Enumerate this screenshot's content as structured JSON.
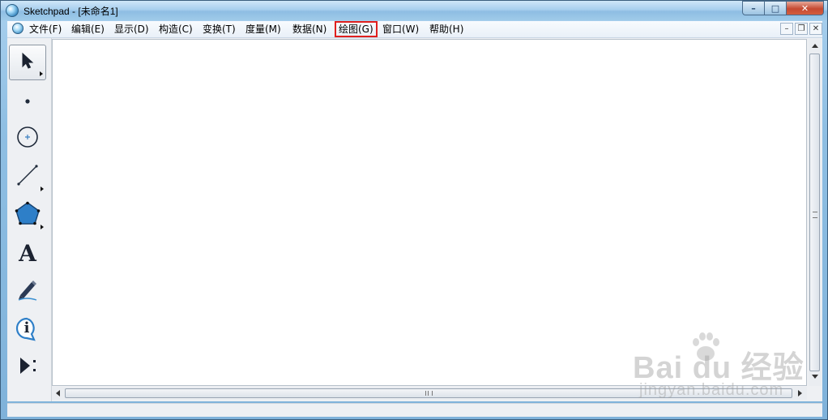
{
  "window": {
    "title": "Sketchpad  - [未命名1]",
    "controls": {
      "minimize": "–",
      "maximize": "□",
      "close": "✕"
    }
  },
  "menubar": {
    "items": [
      {
        "label": "文件(F)"
      },
      {
        "label": "编辑(E)"
      },
      {
        "label": "显示(D)"
      },
      {
        "label": "构造(C)"
      },
      {
        "label": "变换(T)"
      },
      {
        "label": "度量(M)"
      },
      {
        "label": "数据(N)"
      },
      {
        "label": "绘图(G)",
        "highlighted": true
      },
      {
        "label": "窗口(W)"
      },
      {
        "label": "帮助(H)"
      }
    ],
    "mdi_controls": {
      "minimize": "–",
      "restore": "❐",
      "close": "✕"
    },
    "highlight_color": "#e0201e"
  },
  "toolbox": {
    "tools": [
      {
        "name": "arrow-select-tool",
        "icon": "arrow-cursor-icon",
        "active": true
      },
      {
        "name": "point-tool",
        "icon": "point-icon"
      },
      {
        "name": "compass-tool",
        "icon": "circle-icon"
      },
      {
        "name": "straightedge-tool",
        "icon": "segment-icon"
      },
      {
        "name": "polygon-tool",
        "icon": "pentagon-icon"
      },
      {
        "name": "text-tool",
        "icon": "text-a-icon",
        "glyph": "A"
      },
      {
        "name": "marker-tool",
        "icon": "marker-pen-icon"
      },
      {
        "name": "information-tool",
        "icon": "info-icon",
        "glyph": "i"
      },
      {
        "name": "custom-tool",
        "icon": "play-custom-icon"
      }
    ]
  },
  "watermark": {
    "brand": "Bai du 经验",
    "url": "jingyan.baidu.com"
  }
}
